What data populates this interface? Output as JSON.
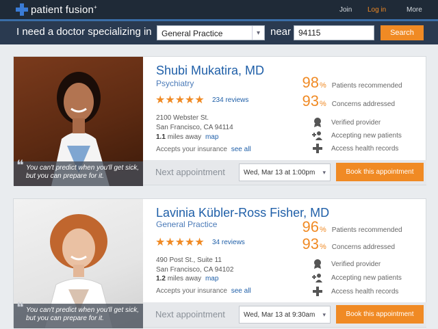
{
  "header": {
    "brand": "patient fusion",
    "brand_mark": "+",
    "nav": {
      "join": "Join",
      "login": "Log in",
      "more": "More"
    }
  },
  "search": {
    "label_prefix": "I need a doctor specializing in",
    "specialty_value": "General Practice",
    "label_near": "near",
    "zip_value": "94115",
    "button": "Search"
  },
  "colors": {
    "accent": "#f08a24",
    "link": "#1f5fa8",
    "nav_bg": "#1f2a37"
  },
  "doctors": [
    {
      "name": "Shubi Mukatira, MD",
      "specialty": "Psychiatry",
      "stars": "★★★★★",
      "rating": 5,
      "reviews": "234 reviews",
      "address1": "2100 Webster St.",
      "address2": "San Francisco, CA 94114",
      "miles": "1.1",
      "miles_suffix": "miles away",
      "map": "map",
      "insurance": "Accepts your insurance",
      "see_all": "see all",
      "quote_mark": "❝",
      "quote": "You can't predict when you'll get sick, but you can prepare for it.",
      "stats": [
        {
          "value": "98",
          "pct": "%",
          "label": "Patients recommended"
        },
        {
          "value": "93",
          "pct": "%",
          "label": "Concerns addressed"
        }
      ],
      "features": [
        {
          "icon": "badge-icon",
          "label": "Verified provider"
        },
        {
          "icon": "add-patient-icon",
          "label": "Accepting new patients"
        },
        {
          "icon": "health-record-icon",
          "label": "Access health records"
        }
      ],
      "next_label": "Next appointment",
      "next_value": "Wed, Mar 13 at 1:00pm",
      "book": "Book this appointment"
    },
    {
      "name": "Lavinia Kübler-Ross Fisher, MD",
      "specialty": "General Practice",
      "stars": "★★★★★",
      "rating": 5,
      "reviews": "34 reviews",
      "address1": "490 Post St., Suite 11",
      "address2": "San Francisco, CA 94102",
      "miles": "1.2",
      "miles_suffix": "miles away",
      "map": "map",
      "insurance": "Accepts your insurance",
      "see_all": "see all",
      "quote_mark": "❝",
      "quote": "You can't predict when you'll get sick, but you can prepare for it.",
      "stats": [
        {
          "value": "96",
          "pct": "%",
          "label": "Patients recommended"
        },
        {
          "value": "93",
          "pct": "%",
          "label": "Concerns addressed"
        }
      ],
      "features": [
        {
          "icon": "badge-icon",
          "label": "Verified provider"
        },
        {
          "icon": "add-patient-icon",
          "label": "Accepting new patients"
        },
        {
          "icon": "health-record-icon",
          "label": "Access health records"
        }
      ],
      "next_label": "Next appointment",
      "next_value": "Wed, Mar 13 at 9:30am",
      "book": "Book this appointment"
    }
  ]
}
